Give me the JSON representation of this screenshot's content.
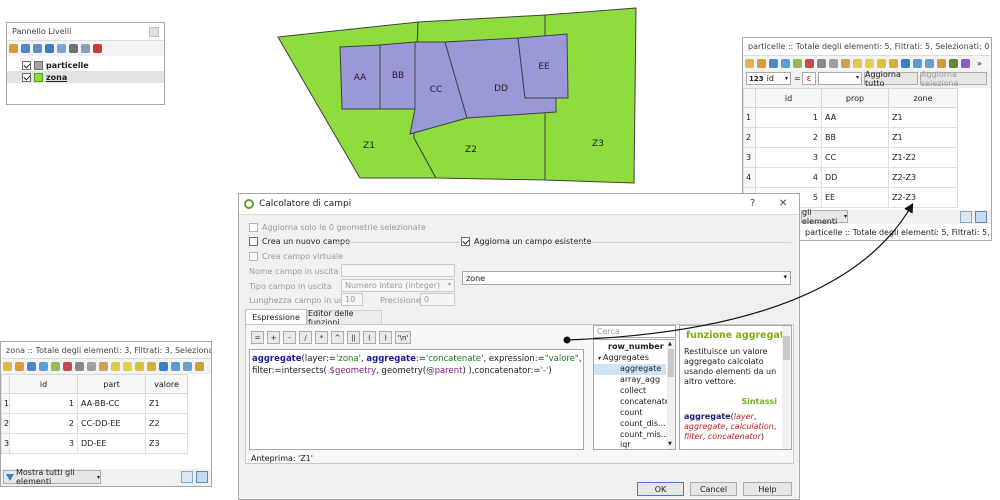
{
  "colors": {
    "zone_fill": "#8fdc3e",
    "parcel_fill": "#9b98d8",
    "outline": "#404040",
    "func_title": "#7aae1a",
    "highlight": "#cfe3f7"
  },
  "layer_panel": {
    "title": "Pannello Livelli",
    "layers": [
      {
        "name": "particelle",
        "checked": true
      },
      {
        "name": "zona",
        "checked": true
      }
    ]
  },
  "map": {
    "parcel_labels": [
      "AA",
      "BB",
      "CC",
      "DD",
      "EE"
    ],
    "zone_labels": [
      "Z1",
      "Z2",
      "Z3"
    ]
  },
  "particelle_table": {
    "title": "particelle :: Totale degli elementi: 5, Filtrati: 5, Selezionati: 0",
    "field_type": "123",
    "field_name": "id",
    "equals": "=",
    "epsilon": "ε",
    "update_all": "Aggiorna tutto",
    "update_selected": "Aggiorna selezione",
    "columns": [
      "id",
      "prop",
      "zone"
    ],
    "rows": [
      [
        "1",
        "1",
        "AA",
        "Z1"
      ],
      [
        "2",
        "2",
        "BB",
        "Z1"
      ],
      [
        "3",
        "3",
        "CC",
        "Z1-Z2"
      ],
      [
        "4",
        "4",
        "DD",
        "Z2-Z3"
      ],
      [
        "5",
        "5",
        "EE",
        "Z2-Z3"
      ]
    ],
    "bottom_button": "gli elementi",
    "status": "particelle :: Totale degli elementi: 5, Filtrati: 5, Sele..."
  },
  "zona_table": {
    "title": "zona :: Totale degli elementi: 3, Filtrati: 3, Selezionati:...",
    "columns": [
      "id",
      "part",
      "valore"
    ],
    "rows": [
      [
        "1",
        "1",
        "AA-BB-CC",
        "Z1"
      ],
      [
        "2",
        "2",
        "CC-DD-EE",
        "Z2"
      ],
      [
        "3",
        "3",
        "DD-EE",
        "Z3"
      ]
    ],
    "show_all": "Mostra tutti gli elementi",
    "more": "»"
  },
  "calculator": {
    "title": "Calcolatore di campi",
    "help_glyph": "?",
    "close_glyph": "✕",
    "only_selected": "Aggiorna solo le 0 geometrie selezionate",
    "new_field": "Crea un nuovo campo",
    "update_existing": "Aggiorna un campo esistente",
    "virtual_field": "Crea campo virtuale",
    "output_name_label": "Nome campo in uscita",
    "output_type_label": "Tipo campo in uscita",
    "output_type_value": "Numero intero (integer)",
    "length_label": "Lunghezza campo in uscita",
    "length_value": "10",
    "precision_label": "Precisione",
    "precision_value": "0",
    "existing_field": "zone",
    "tab_expression": "Espressione",
    "tab_editor": "Editor delle funzioni",
    "operators": [
      "=",
      "+",
      "-",
      "/",
      "*",
      "^",
      "||",
      "(",
      ")",
      "'\\n'"
    ],
    "expression": {
      "l1_fn": "aggregate",
      "l1_a": "(",
      "l1_kw1": "layer",
      "l1_b": ":=",
      "l1_s1": "'zona'",
      "l1_c": ", ",
      "l1_kw2": "aggregate",
      "l1_d": ":=",
      "l1_s2": "'concatenate'",
      "l1_e": ", expression:=",
      "l1_s3": "\"valore\"",
      "l1_f": ",",
      "l2_a": "filter:=intersects( ",
      "l2_v": "$geometry",
      "l2_b": ", geometry(",
      "l2_p": "@parent",
      "l2_c": ") ),concatenator:=",
      "l2_s": "'-'",
      "l2_d": ")"
    },
    "search_placeholder": "Cerca",
    "tree": [
      "row_number",
      "Aggregates",
      "aggregate",
      "array_agg",
      "collect",
      "concatenate",
      "count",
      "count_dis...",
      "count_mis...",
      "iqr"
    ],
    "func_title": "funzione aggregate",
    "func_desc": "Restituisce un valore aggregato calcolato usando elementi da un altro vettore.",
    "syntax_title": "Sintassi",
    "syntax": {
      "fname": "aggregate",
      "open": "(",
      "p1": "layer",
      "p2": "aggregate",
      "p3": "calculation",
      "p4": "filter",
      "p5": "concatenator",
      "sep": ", ",
      "close": ")"
    },
    "preview_label": "Anteprima:",
    "preview_value": "'Z1'",
    "ok": "OK",
    "cancel": "Cancel",
    "help": "Help"
  }
}
